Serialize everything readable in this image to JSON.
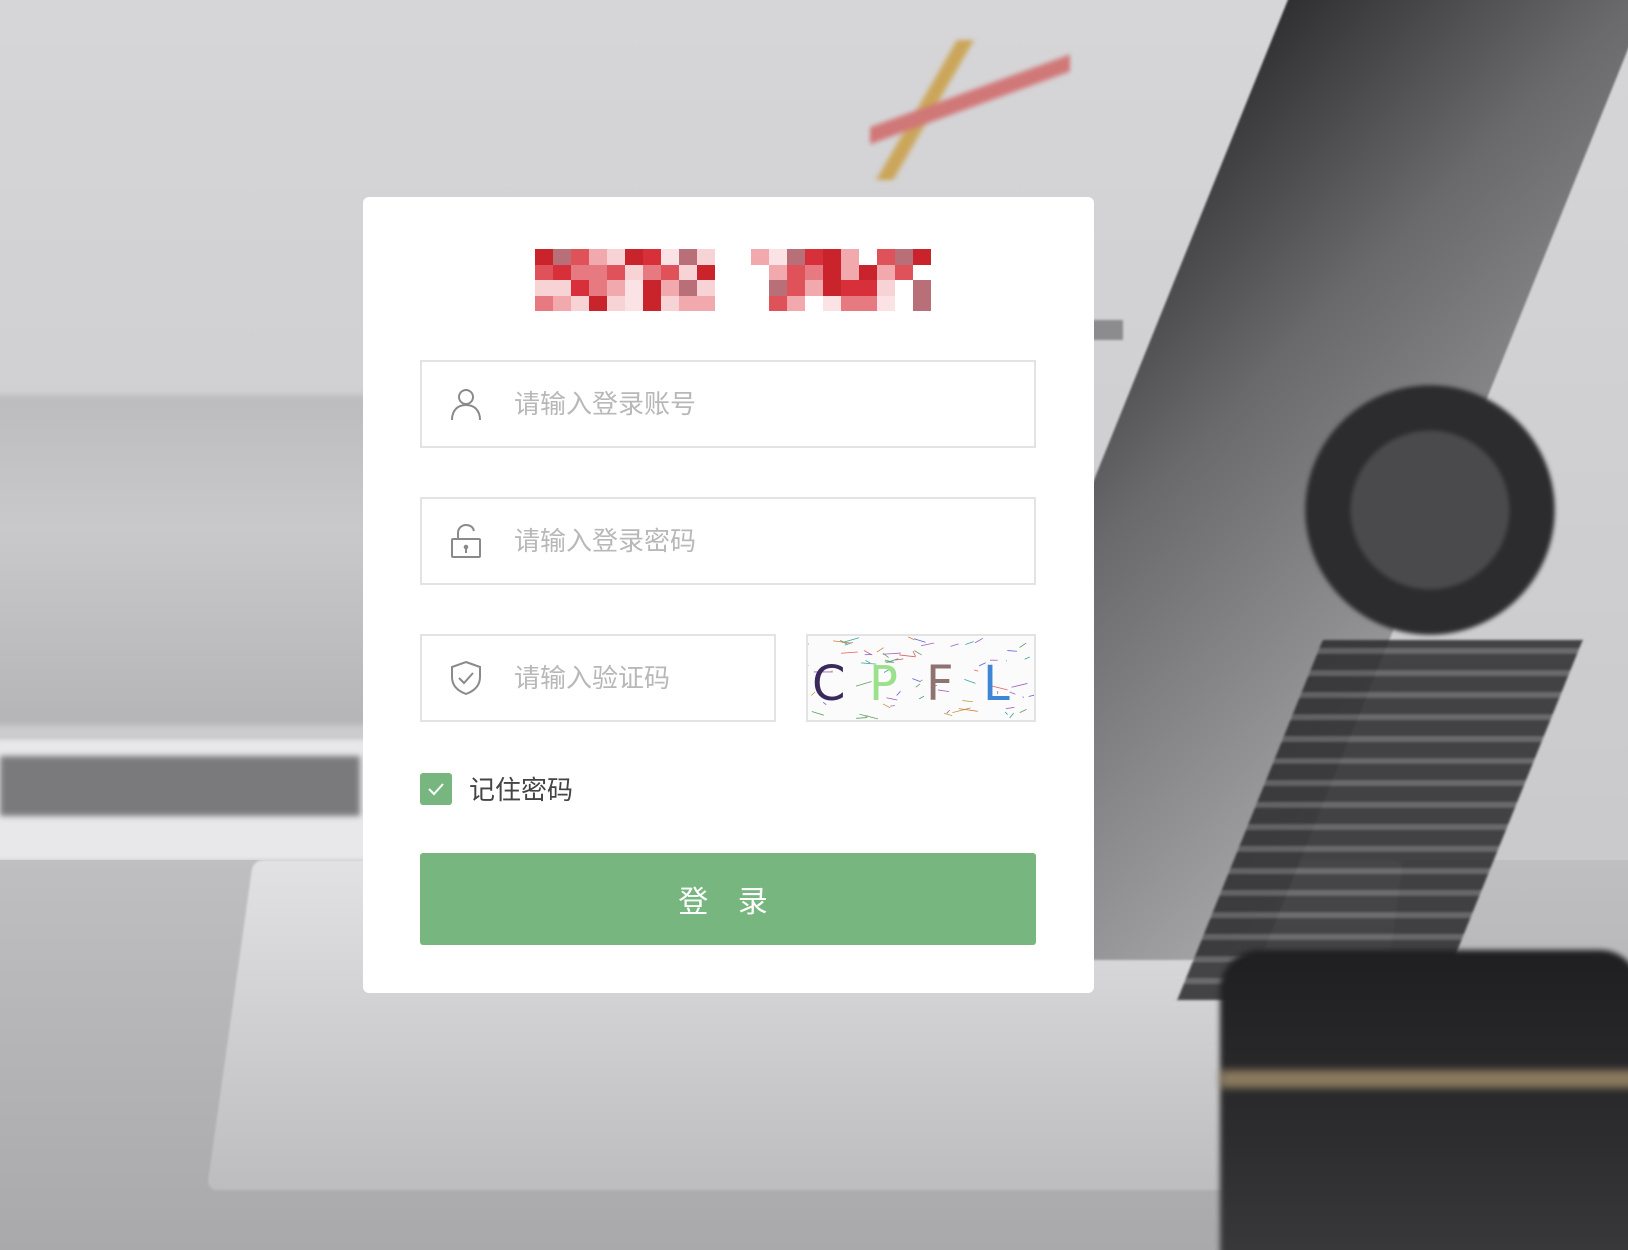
{
  "login": {
    "username_placeholder": "请输入登录账号",
    "username_value": "",
    "password_placeholder": "请输入登录密码",
    "password_value": "",
    "captcha_placeholder": "请输入验证码",
    "captcha_value": "",
    "captcha_image_text": "CPFL",
    "remember_label": "记住密码",
    "remember_checked": true,
    "submit_label": "登 录"
  },
  "colors": {
    "accent": "#77b77f",
    "logo_red": "#d8303a",
    "border": "#e3e3e3",
    "placeholder": "#b8b8b8"
  },
  "icons": {
    "username": "user-icon",
    "password": "lock-icon",
    "captcha": "shield-check-icon",
    "remember": "check-icon"
  }
}
